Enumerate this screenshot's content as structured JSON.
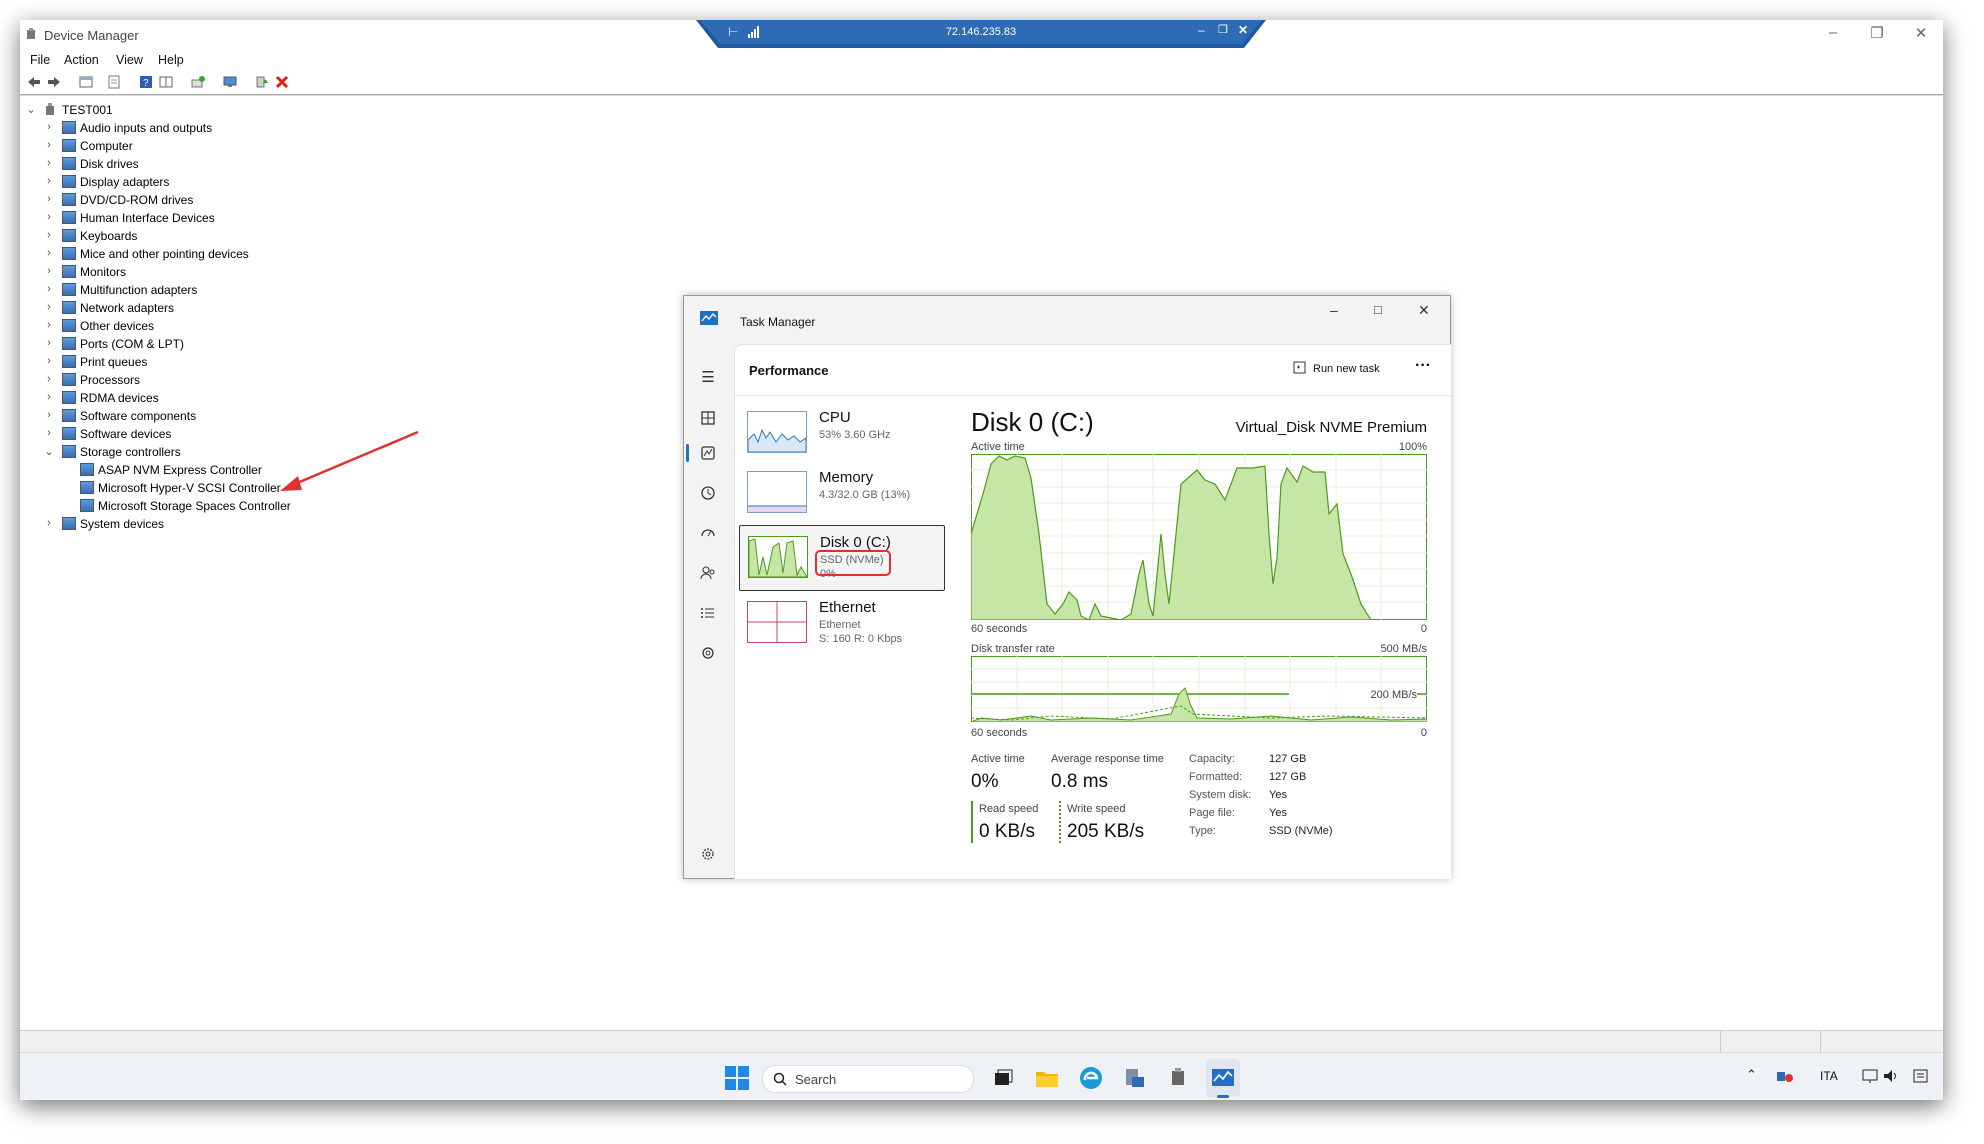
{
  "device_manager": {
    "title": "Device Manager",
    "menu": [
      "File",
      "Action",
      "View",
      "Help"
    ],
    "root": "TEST001",
    "categories": [
      {
        "label": "Audio inputs and outputs",
        "icon": "speaker-icon"
      },
      {
        "label": "Computer",
        "icon": "computer-icon"
      },
      {
        "label": "Disk drives",
        "icon": "disk-drive-icon"
      },
      {
        "label": "Display adapters",
        "icon": "display-adapter-icon"
      },
      {
        "label": "DVD/CD-ROM drives",
        "icon": "dvd-icon"
      },
      {
        "label": "Human Interface Devices",
        "icon": "hid-icon"
      },
      {
        "label": "Keyboards",
        "icon": "keyboard-icon"
      },
      {
        "label": "Mice and other pointing devices",
        "icon": "mouse-icon"
      },
      {
        "label": "Monitors",
        "icon": "monitor-icon"
      },
      {
        "label": "Multifunction adapters",
        "icon": "multifunction-icon"
      },
      {
        "label": "Network adapters",
        "icon": "network-adapter-icon"
      },
      {
        "label": "Other devices",
        "icon": "other-devices-icon"
      },
      {
        "label": "Ports (COM & LPT)",
        "icon": "port-icon"
      },
      {
        "label": "Print queues",
        "icon": "printer-icon"
      },
      {
        "label": "Processors",
        "icon": "processor-icon"
      },
      {
        "label": "RDMA devices",
        "icon": "rdma-icon"
      },
      {
        "label": "Software components",
        "icon": "software-component-icon"
      },
      {
        "label": "Software devices",
        "icon": "software-device-icon"
      },
      {
        "label": "Storage controllers",
        "icon": "storage-controller-icon"
      }
    ],
    "storage_children": [
      "ASAP NVM Express Controller",
      "Microsoft Hyper-V SCSI Controller",
      "Microsoft Storage Spaces Controller"
    ],
    "last_category": "System devices"
  },
  "remote_bar": {
    "address": "72.146.235.83"
  },
  "task_manager": {
    "title": "Task Manager",
    "page": "Performance",
    "run_new_task": "Run new task",
    "more": "···",
    "items": [
      {
        "name": "CPU",
        "sub1": "53% 3.60 GHz",
        "sub2": ""
      },
      {
        "name": "Memory",
        "sub1": "4.3/32.0 GB (13%)",
        "sub2": ""
      },
      {
        "name": "Disk 0 (C:)",
        "sub1": "SSD (NVMe)",
        "sub2": "0%"
      },
      {
        "name": "Ethernet",
        "sub1": "Ethernet",
        "sub2": "S: 160 R: 0 Kbps"
      }
    ],
    "detail": {
      "heading": "Disk 0 (C:)",
      "model": "Virtual_Disk NVME Premium",
      "active_time_label": "Active time",
      "active_time_max": "100%",
      "seconds_label_1": "60 seconds",
      "zero_1": "0",
      "transfer_label": "Disk transfer rate",
      "transfer_max": "500 MB/s",
      "transfer_mid": "200 MB/s",
      "seconds_label_2": "60 seconds",
      "zero_2": "0",
      "stat_active_label": "Active time",
      "stat_active_value": "0%",
      "stat_response_label": "Average response time",
      "stat_response_value": "0.8 ms",
      "read_label": "Read speed",
      "read_value": "0 KB/s",
      "write_label": "Write speed",
      "write_value": "205 KB/s",
      "props": [
        {
          "k": "Capacity:",
          "v": "127 GB"
        },
        {
          "k": "Formatted:",
          "v": "127 GB"
        },
        {
          "k": "System disk:",
          "v": "Yes"
        },
        {
          "k": "Page file:",
          "v": "Yes"
        },
        {
          "k": "Type:",
          "v": "SSD (NVMe)"
        }
      ]
    }
  },
  "taskbar": {
    "search_placeholder": "Search",
    "lang": "ITA"
  },
  "colors": {
    "accent": "#1a4f8f",
    "graph_fill": "#c6e6a6",
    "graph_line": "#4f9a1e",
    "highlight": "#e03030"
  }
}
